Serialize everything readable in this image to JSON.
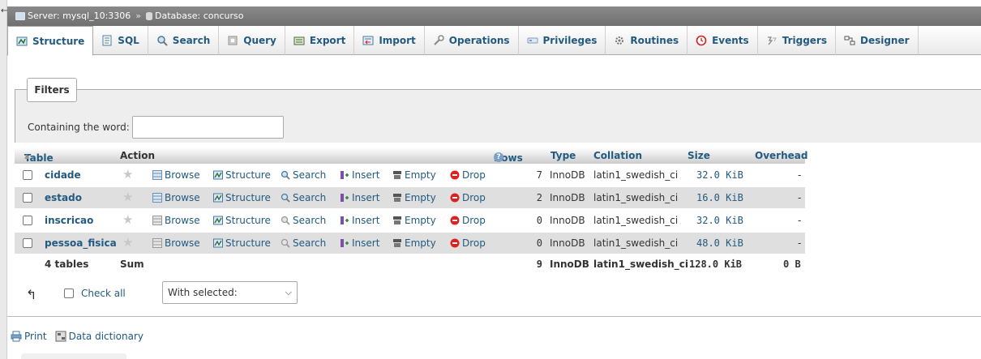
{
  "breadcrumb": {
    "back_glyph": "←",
    "server": "Server: mysql_10:3306",
    "separator": "»",
    "database": "Database: concurso"
  },
  "tabs": [
    {
      "label": "Structure",
      "icon": "structure-icon",
      "active": true
    },
    {
      "label": "SQL",
      "icon": "sql-icon"
    },
    {
      "label": "Search",
      "icon": "search-icon"
    },
    {
      "label": "Query",
      "icon": "query-icon"
    },
    {
      "label": "Export",
      "icon": "export-icon"
    },
    {
      "label": "Import",
      "icon": "import-icon"
    },
    {
      "label": "Operations",
      "icon": "wrench-icon"
    },
    {
      "label": "Privileges",
      "icon": "privileges-icon"
    },
    {
      "label": "Routines",
      "icon": "routines-icon"
    },
    {
      "label": "Events",
      "icon": "clock-icon"
    },
    {
      "label": "Triggers",
      "icon": "triggers-icon"
    },
    {
      "label": "Designer",
      "icon": "designer-icon"
    }
  ],
  "filters": {
    "legend": "Filters",
    "label": "Containing the word:",
    "value": ""
  },
  "table": {
    "headers": {
      "table": "Table",
      "sort_glyph": "▲",
      "action": "Action",
      "rows": "Rows",
      "help_glyph": "?",
      "type": "Type",
      "collation": "Collation",
      "size": "Size",
      "overhead": "Overhead"
    },
    "actions": [
      "Browse",
      "Structure",
      "Search",
      "Insert",
      "Empty",
      "Drop"
    ],
    "rows": [
      {
        "name": "cidade",
        "rows": "7",
        "type": "InnoDB",
        "collation": "latin1_swedish_ci",
        "size": "32.0 KiB",
        "overhead": "-"
      },
      {
        "name": "estado",
        "rows": "2",
        "type": "InnoDB",
        "collation": "latin1_swedish_ci",
        "size": "16.0 KiB",
        "overhead": "-"
      },
      {
        "name": "inscricao",
        "rows": "0",
        "type": "InnoDB",
        "collation": "latin1_swedish_ci",
        "size": "32.0 KiB",
        "overhead": "-"
      },
      {
        "name": "pessoa_fisica",
        "rows": "0",
        "type": "InnoDB",
        "collation": "latin1_swedish_ci",
        "size": "48.0 KiB",
        "overhead": "-"
      }
    ],
    "summary": {
      "tables": "4 tables",
      "label": "Sum",
      "rows": "9",
      "type": "InnoDB",
      "collation": "latin1_swedish_ci",
      "size": "128.0 KiB",
      "overhead": "0 B"
    }
  },
  "bulk": {
    "check_all": "Check all",
    "with_selected": "With selected:"
  },
  "footer": {
    "print": "Print",
    "data_dictionary": "Data dictionary"
  },
  "colors": {
    "link": "#235a81",
    "breadcrumb_bg": "#7a7a7a",
    "row_alt": "#dfdfdf",
    "drop_red": "#e02020"
  }
}
